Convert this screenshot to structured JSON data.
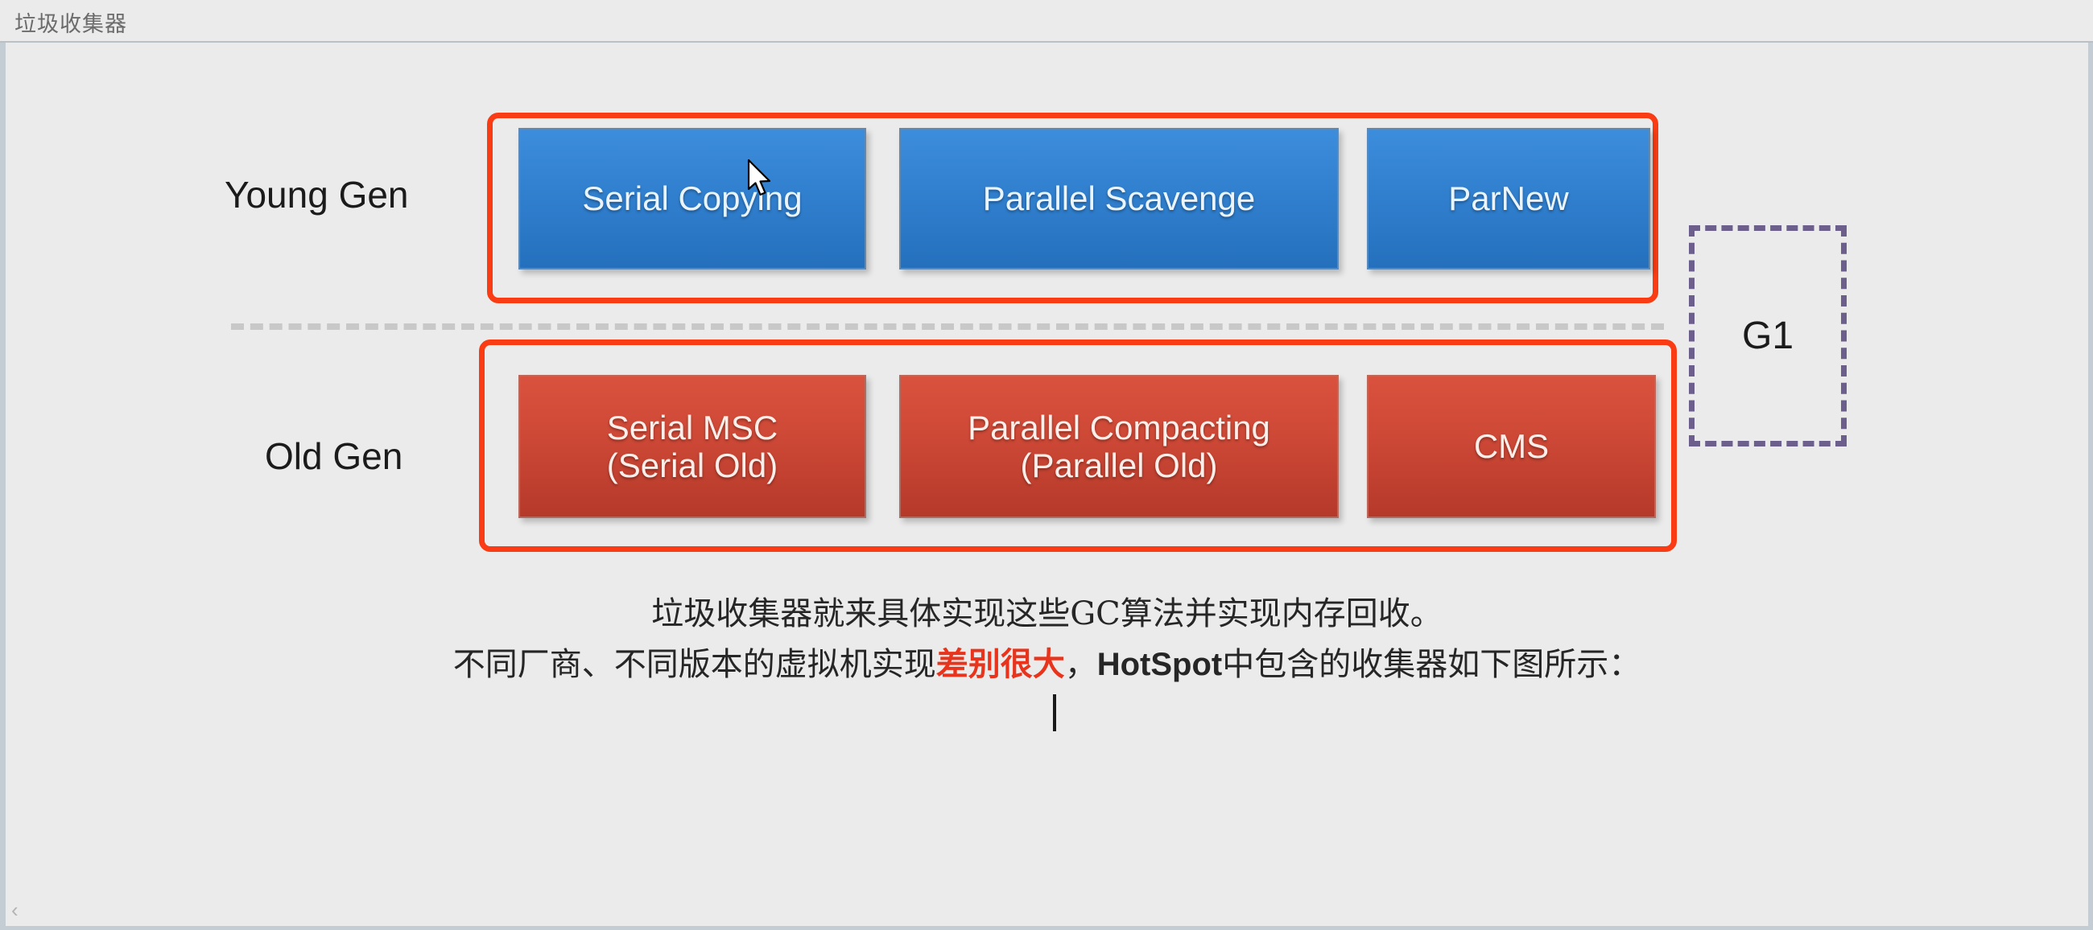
{
  "window": {
    "title": "垃圾收集器",
    "prev_chevron": "‹"
  },
  "diagram": {
    "young_gen_label": "Young Gen",
    "old_gen_label": "Old Gen",
    "young_collectors": [
      {
        "name": "Serial Copying",
        "line1": "Serial Copying",
        "line2": ""
      },
      {
        "name": "Parallel Scavenge",
        "line1": "Parallel Scavenge",
        "line2": ""
      },
      {
        "name": "ParNew",
        "line1": "ParNew",
        "line2": ""
      }
    ],
    "old_collectors": [
      {
        "name": "Serial MSC",
        "line1": "Serial MSC",
        "line2": "(Serial Old)"
      },
      {
        "name": "Parallel Compacting",
        "line1": "Parallel Compacting",
        "line2": "(Parallel Old)"
      },
      {
        "name": "CMS",
        "line1": "CMS",
        "line2": ""
      }
    ],
    "g1_label": "G1",
    "colors": {
      "young_box": "#3180cf",
      "old_box": "#cf4937",
      "group_outline": "#f93c13",
      "g1_outline": "#6c5f8c",
      "divider": "#c8c8c8",
      "canvas_bg": "#ebebeb"
    }
  },
  "caption": {
    "line1": "垃圾收集器就来具体实现这些GC算法并实现内存回收。",
    "line2_part1": "不同厂商、不同版本的虚拟机实现",
    "line2_highlight": "差别很大",
    "line2_part2": "，",
    "line2_latin": "HotSpot",
    "line2_part3": "中包含的收集器如下图所示："
  }
}
